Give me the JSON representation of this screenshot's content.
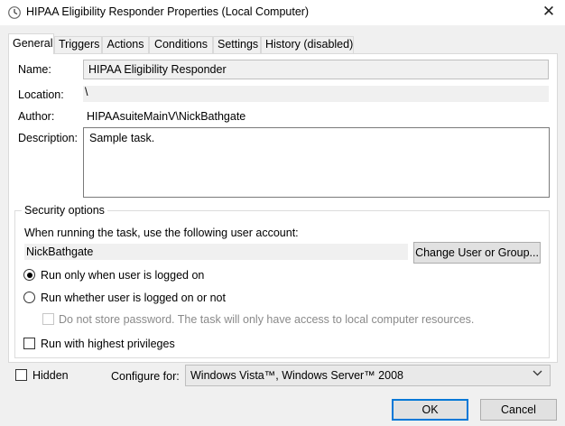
{
  "window": {
    "title": "HIPAA Eligibility Responder Properties (Local Computer)",
    "close_glyph": "✕"
  },
  "tabs": [
    {
      "label": "General",
      "active": true
    },
    {
      "label": "Triggers",
      "active": false
    },
    {
      "label": "Actions",
      "active": false
    },
    {
      "label": "Conditions",
      "active": false
    },
    {
      "label": "Settings",
      "active": false
    },
    {
      "label": "History (disabled)",
      "active": false
    }
  ],
  "general": {
    "name_label": "Name:",
    "name_value": "HIPAA Eligibility Responder",
    "location_label": "Location:",
    "location_value": "\\",
    "author_label": "Author:",
    "author_value": "HIPAAsuiteMainV\\NickBathgate",
    "description_label": "Description:",
    "description_value": "Sample task."
  },
  "security": {
    "legend": "Security options",
    "account_prompt": "When running the task, use the following user account:",
    "account_value": "NickBathgate",
    "change_user_label": "Change User or Group...",
    "run_logged_on_label": "Run only when user is logged on",
    "run_whether_label": "Run whether user is logged on or not",
    "no_store_password_label": "Do not store password.  The task will only have access to local computer resources.",
    "highest_privileges_label": "Run with highest privileges",
    "run_mode_selected": "logged_on",
    "no_store_password_checked": false,
    "highest_privileges_checked": false
  },
  "footer": {
    "hidden_label": "Hidden",
    "hidden_checked": false,
    "configure_label": "Configure for:",
    "configure_value": "Windows Vista™, Windows Server™ 2008",
    "ok_label": "OK",
    "cancel_label": "Cancel"
  },
  "colors": {
    "accent": "#0078d7",
    "window_bg": "#f0f0f0",
    "panel_bg": "#ffffff"
  },
  "icons": [
    "task-scheduler-icon",
    "close-icon",
    "chevron-down-icon"
  ]
}
